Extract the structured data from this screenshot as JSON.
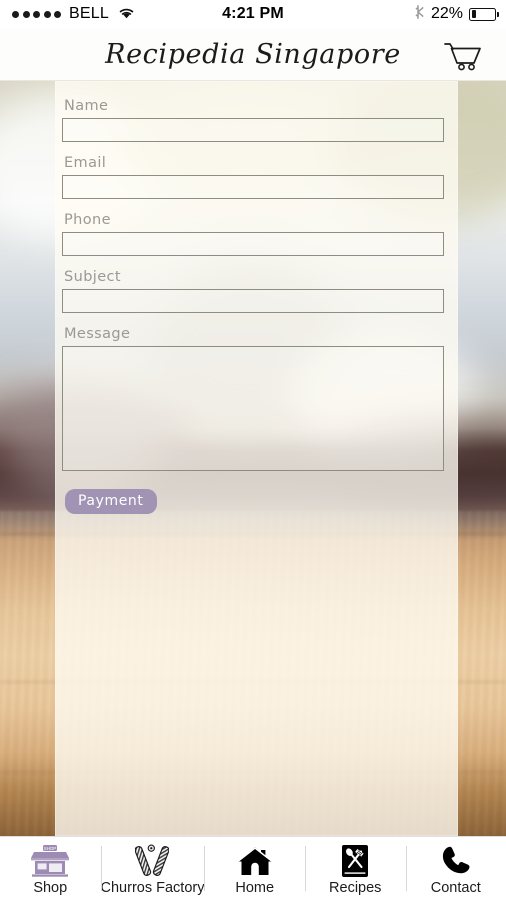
{
  "status_bar": {
    "signal_dots": 5,
    "carrier": "BELL",
    "wifi_icon": "wifi-icon",
    "time": "4:21 PM",
    "bluetooth_icon": "bluetooth-icon",
    "battery_percent": "22%",
    "battery_level": 22
  },
  "header": {
    "title": "Recipedia Singapore",
    "cart_icon": "shopping-cart-icon"
  },
  "form": {
    "fields": [
      {
        "label": "Name",
        "value": "",
        "placeholder": "",
        "type": "text"
      },
      {
        "label": "Email",
        "value": "",
        "placeholder": "",
        "type": "email"
      },
      {
        "label": "Phone",
        "value": "",
        "placeholder": "",
        "type": "tel"
      },
      {
        "label": "Subject",
        "value": "",
        "placeholder": "",
        "type": "text"
      },
      {
        "label": "Message",
        "value": "",
        "placeholder": "",
        "type": "textarea"
      }
    ],
    "submit_label": "Payment",
    "submit_color": "#a193b4",
    "label_color": "#9a9a92",
    "input_border_color": "#8d8d80"
  },
  "tab_bar": {
    "items": [
      {
        "label": "Shop",
        "icon": "storefront-icon",
        "color": "#9d8bb3",
        "active": false
      },
      {
        "label": "Churros Factory",
        "icon": "churros-icon",
        "color": "#1c1c1c",
        "active": false
      },
      {
        "label": "Home",
        "icon": "house-icon",
        "color": "#000000",
        "active": false
      },
      {
        "label": "Recipes",
        "icon": "recipe-book-icon",
        "color": "#000000",
        "active": false
      },
      {
        "label": "Contact",
        "icon": "phone-handset-icon",
        "color": "#000000",
        "active": true
      }
    ]
  },
  "theme": {
    "panel_background": "rgba(255,253,243,0.78)",
    "accent": "#a193b4",
    "page_background": "#ffffff"
  }
}
